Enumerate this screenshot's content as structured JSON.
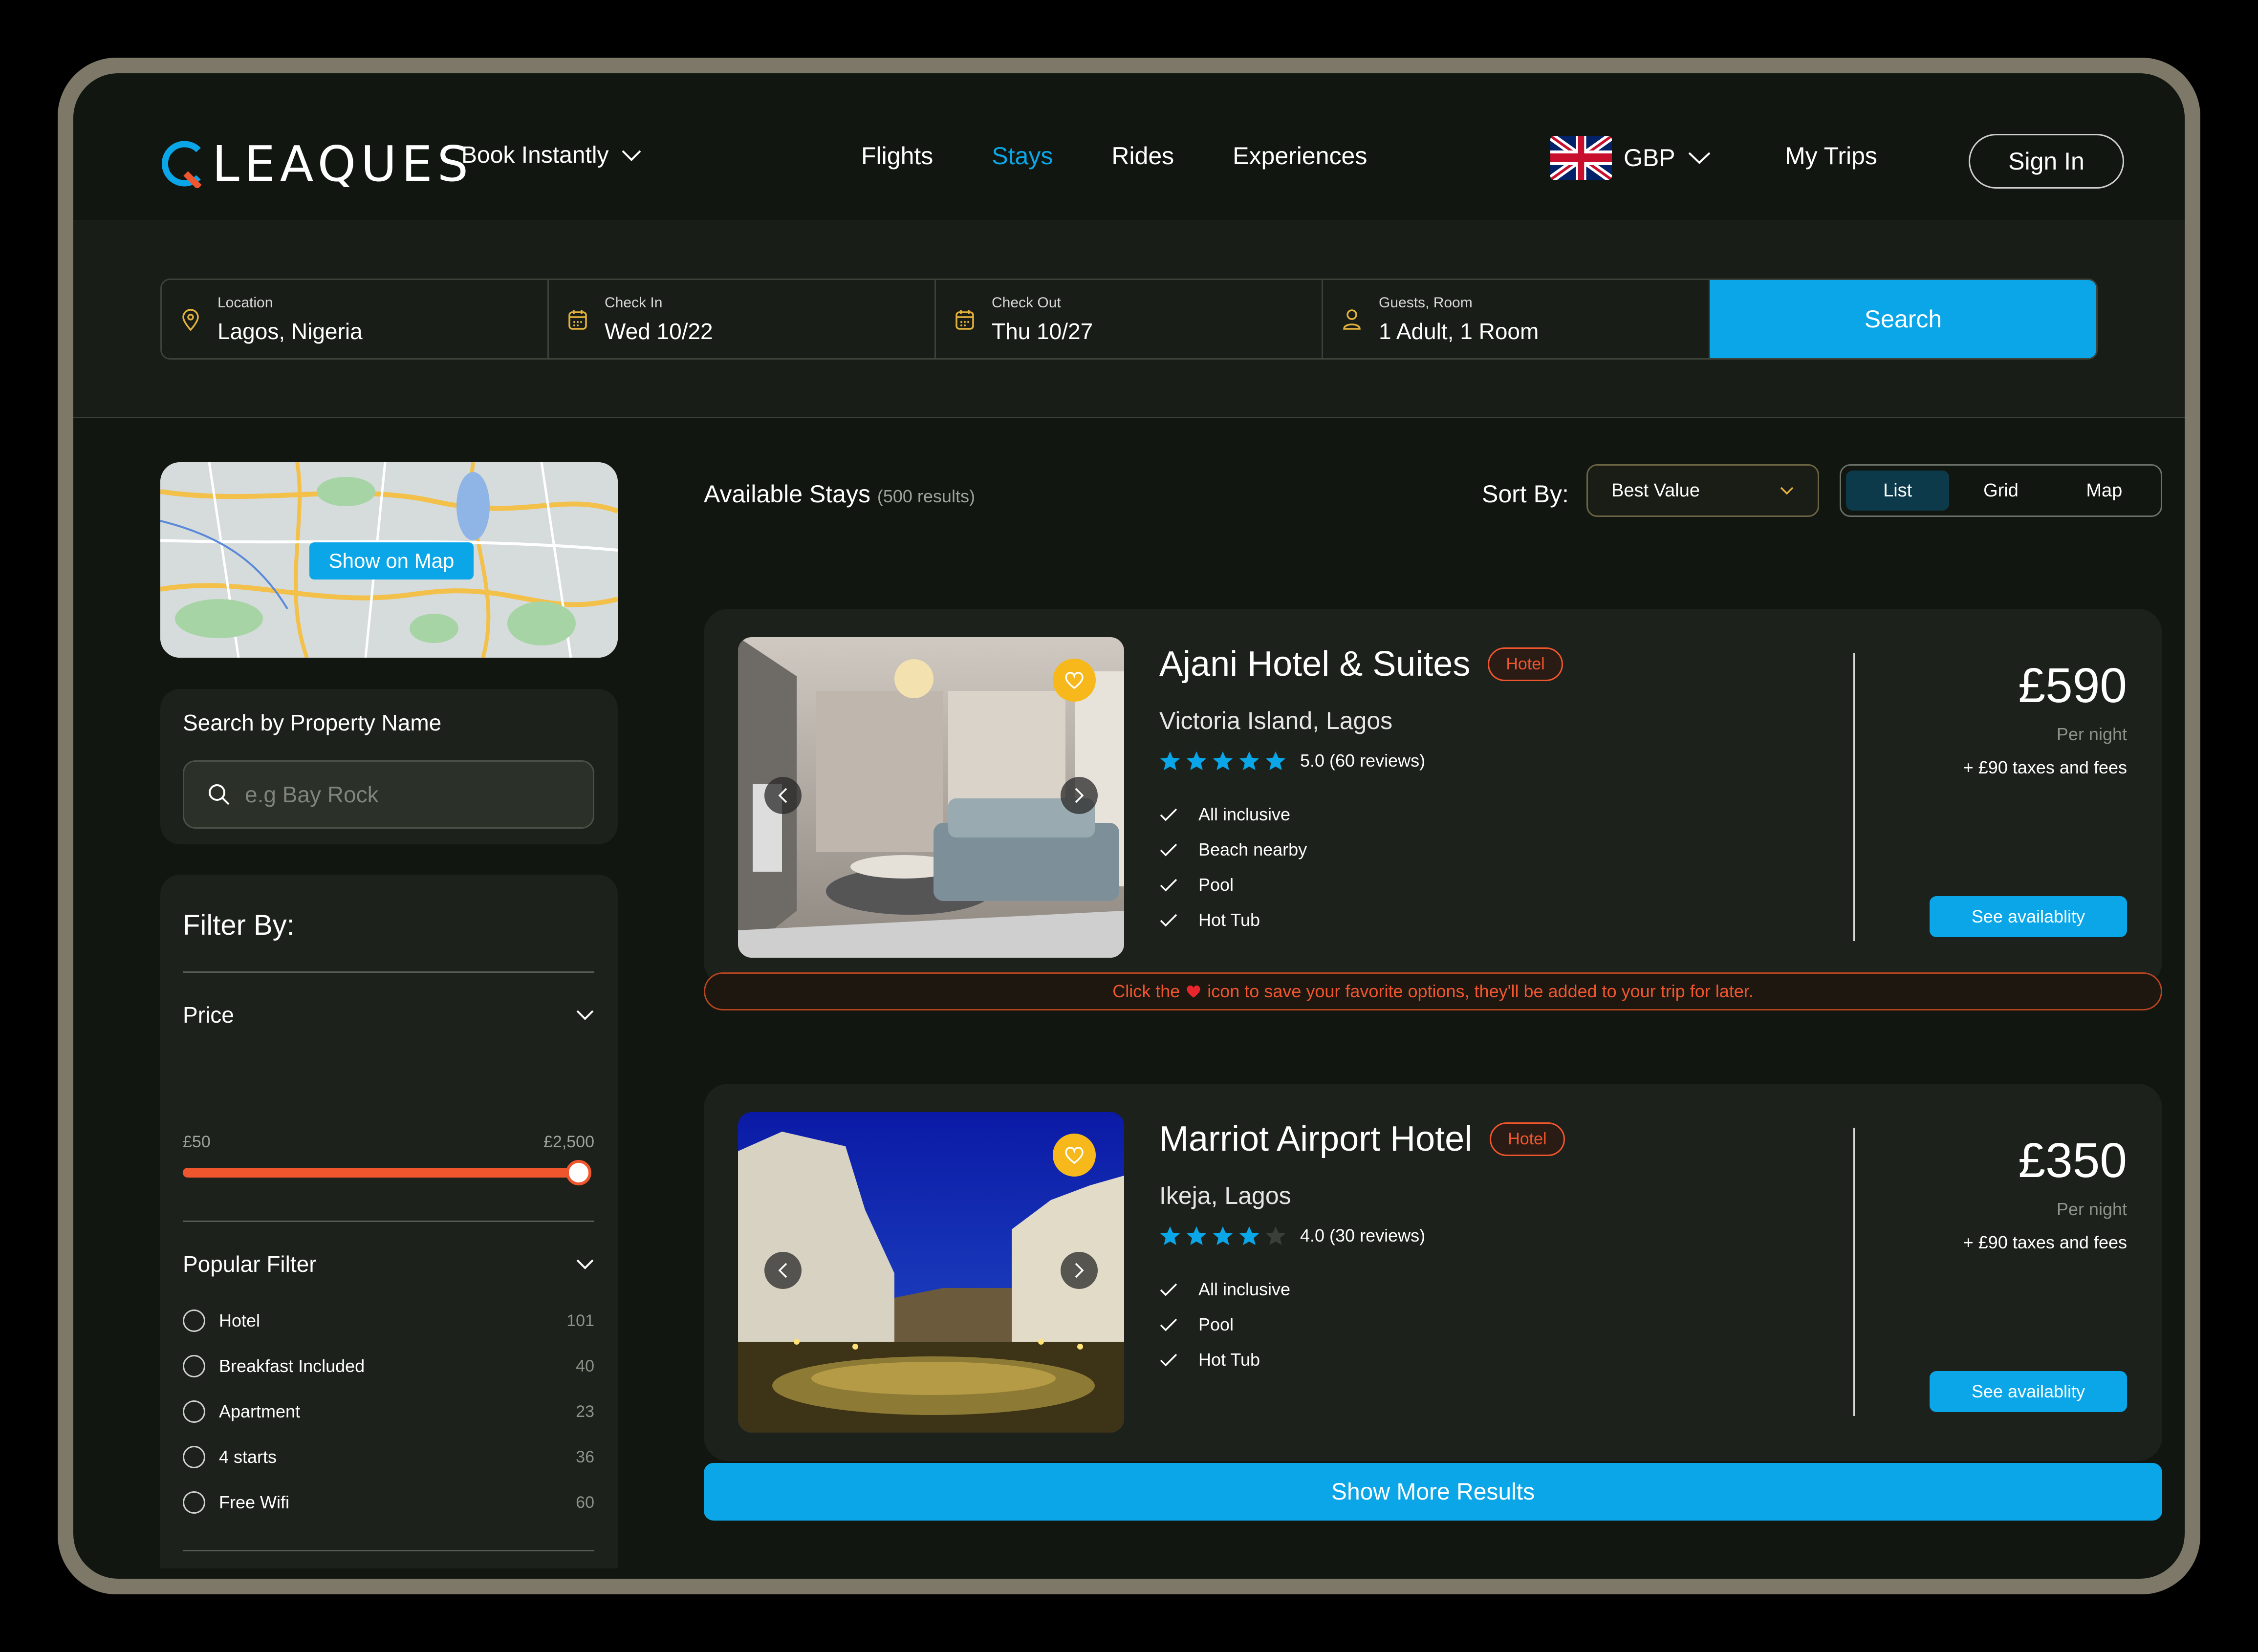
{
  "brand": {
    "name": "LEAQUES",
    "accent": "#0aa6e8",
    "orange": "#f0562e"
  },
  "header": {
    "book_instantly": "Book Instantly",
    "nav": [
      "Flights",
      "Stays",
      "Rides",
      "Experiences"
    ],
    "active_nav": "Stays",
    "currency": "GBP",
    "my_trips": "My Trips",
    "sign_in": "Sign In"
  },
  "search": {
    "location_label": "Location",
    "location_value": "Lagos, Nigeria",
    "checkin_label": "Check In",
    "checkin_value": "Wed 10/22",
    "checkout_label": "Check Out",
    "checkout_value": "Thu 10/27",
    "guests_label": "Guests, Room",
    "guests_value": "1 Adult, 1 Room",
    "button": "Search"
  },
  "sidebar": {
    "show_on_map": "Show on Map",
    "property_search_title": "Search by Property Name",
    "property_search_placeholder": "e.g Bay Rock",
    "filter_title": "Filter By:",
    "price_title": "Price",
    "price_min": "£50",
    "price_max": "£2,500",
    "price_slider_level": 1.0,
    "popular_title": "Popular Filter",
    "popular": [
      {
        "label": "Hotel",
        "count": "101"
      },
      {
        "label": "Breakfast Included",
        "count": "40"
      },
      {
        "label": "Apartment",
        "count": "23"
      },
      {
        "label": "4 starts",
        "count": "36"
      },
      {
        "label": "Free Wifi",
        "count": "60"
      }
    ]
  },
  "results": {
    "title": "Available Stays",
    "count_text": "(500 results)",
    "sort_label": "Sort By:",
    "sort_value": "Best Value",
    "views": [
      "List",
      "Grid",
      "Map"
    ],
    "active_view": "List",
    "tip_before": "Click the",
    "tip_after": "icon to save your favorite options, they'll be added to your trip for later.",
    "show_more": "Show More Results"
  },
  "hotels": [
    {
      "name": "Ajani Hotel & Suites",
      "type": "Hotel",
      "location": "Victoria Island, Lagos",
      "stars": 5,
      "rating_text": "5.0 (60 reviews)",
      "amenities": [
        "All inclusive",
        "Beach nearby",
        "Pool",
        "Hot Tub"
      ],
      "price": "£590",
      "per_night": "Per night",
      "taxes": "+ £90 taxes and fees",
      "cta": "See availablity"
    },
    {
      "name": "Marriot Airport Hotel",
      "type": "Hotel",
      "location": "Ikeja, Lagos",
      "stars": 4,
      "rating_text": "4.0 (30 reviews)",
      "amenities": [
        "All inclusive",
        "Pool",
        "Hot Tub"
      ],
      "price": "£350",
      "per_night": "Per night",
      "taxes": "+ £90 taxes and fees",
      "cta": "See availablity"
    }
  ]
}
